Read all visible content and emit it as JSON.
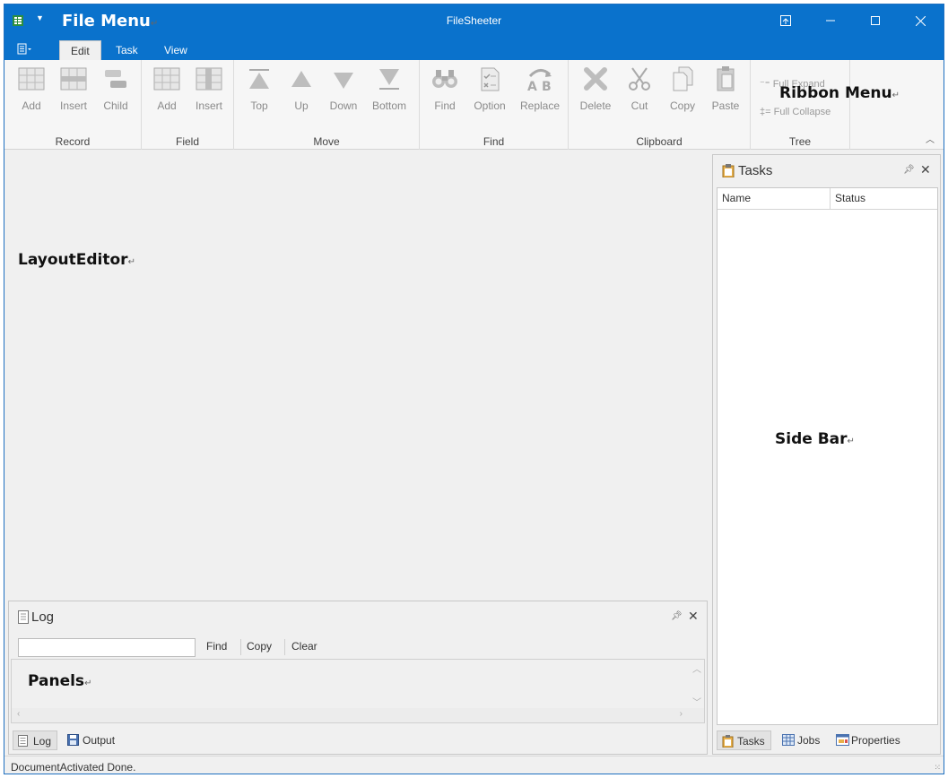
{
  "window": {
    "title": "FileSheeter",
    "annotation_file_menu": "File Menu"
  },
  "tabs": [
    {
      "label": "Edit"
    },
    {
      "label": "Task"
    },
    {
      "label": "View"
    }
  ],
  "ribbon": {
    "annotation": "Ribbon Menu",
    "groups": {
      "record": {
        "label": "Record",
        "buttons": [
          "Add",
          "Insert",
          "Child"
        ]
      },
      "field": {
        "label": "Field",
        "buttons": [
          "Add",
          "Insert"
        ]
      },
      "move": {
        "label": "Move",
        "buttons": [
          "Top",
          "Up",
          "Down",
          "Bottom"
        ]
      },
      "find": {
        "label": "Find",
        "buttons": [
          "Find",
          "Option",
          "Replace"
        ]
      },
      "clipboard": {
        "label": "Clipboard",
        "buttons": [
          "Delete",
          "Cut",
          "Copy",
          "Paste"
        ]
      },
      "tree": {
        "label": "Tree",
        "buttons": [
          "Full Expand",
          "Full Collapse"
        ]
      }
    }
  },
  "editor": {
    "annotation": "LayoutEditor"
  },
  "sidebar": {
    "annotation": "Side Bar",
    "panel_title": "Tasks",
    "columns": [
      "Name",
      "Status"
    ],
    "bottom_tabs": [
      {
        "label": "Tasks",
        "icon": "clipboard-icon"
      },
      {
        "label": "Jobs",
        "icon": "grid-icon"
      },
      {
        "label": "Properties",
        "icon": "properties-icon"
      }
    ]
  },
  "log": {
    "annotation": "Panels",
    "panel_title": "Log",
    "search_value": "",
    "buttons": [
      "Find",
      "Copy",
      "Clear"
    ],
    "bottom_tabs": [
      {
        "label": "Log",
        "icon": "document-icon"
      },
      {
        "label": "Output",
        "icon": "save-icon"
      }
    ]
  },
  "status": {
    "text": "DocumentActivated Done."
  },
  "colors": {
    "title_bar": "#0a72cc",
    "ribbon_bg": "#f6f6f6",
    "disabled_text": "#8a8a8a"
  }
}
